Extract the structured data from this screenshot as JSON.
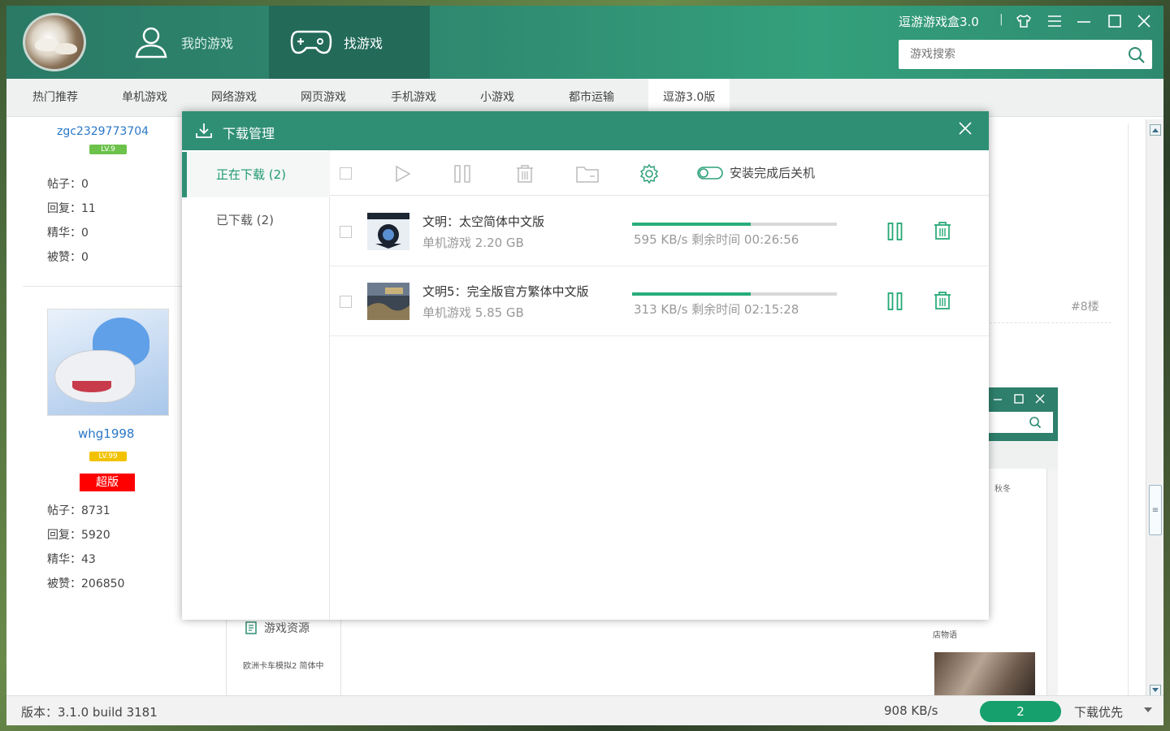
{
  "header": {
    "tabs": [
      {
        "label": "我的游戏"
      },
      {
        "label": "找游戏"
      }
    ],
    "app_title": "逗游游戏盒3.0",
    "search_placeholder": "游戏搜索"
  },
  "categories": [
    "热门推荐",
    "单机游戏",
    "网络游戏",
    "网页游戏",
    "手机游戏",
    "小游戏",
    "都市运输",
    "逗游3.0版"
  ],
  "forum": {
    "user1": {
      "name": "zgc2329773704",
      "level": "LV.9",
      "stats": [
        "帖子：0",
        "回复：11",
        "精华：0",
        "被赞：0"
      ]
    },
    "user2": {
      "name": "whg1998",
      "level": "LV.99",
      "badge": "超版",
      "stats": [
        "帖子：8731",
        "回复：5920",
        "精华：43",
        "被赞：206850"
      ]
    },
    "floor": "#8楼",
    "resources_title": "游戏资源",
    "resource_item": "欧洲卡车模拟2 简体中",
    "mini_text1": "秋冬",
    "mini_text2": "店物语"
  },
  "status": {
    "version": "版本：3.1.0 build 3181",
    "total_speed": "908 KB/s",
    "download_count": "2",
    "priority": "下载优先"
  },
  "download_manager": {
    "title": "下载管理",
    "tabs": [
      {
        "label": "正在下载 (2)",
        "active": true
      },
      {
        "label": "已下载 (2)",
        "active": false
      }
    ],
    "toolbar": {
      "shutdown_label": "安装完成后关机"
    },
    "items": [
      {
        "name": "文明：太空简体中文版",
        "meta": "单机游戏  2.20 GB",
        "progress": 0.58,
        "speed": "595 KB/s  剩余时间 00:26:56"
      },
      {
        "name": "文明5：完全版官方繁体中文版",
        "meta": "单机游戏  5.85 GB",
        "progress": 0.58,
        "speed": "313 KB/s  剩余时间 02:15:28"
      }
    ]
  },
  "colors": {
    "accent": "#2f8f74",
    "progress": "#27ad7b",
    "badge_red": "#ff0000"
  }
}
